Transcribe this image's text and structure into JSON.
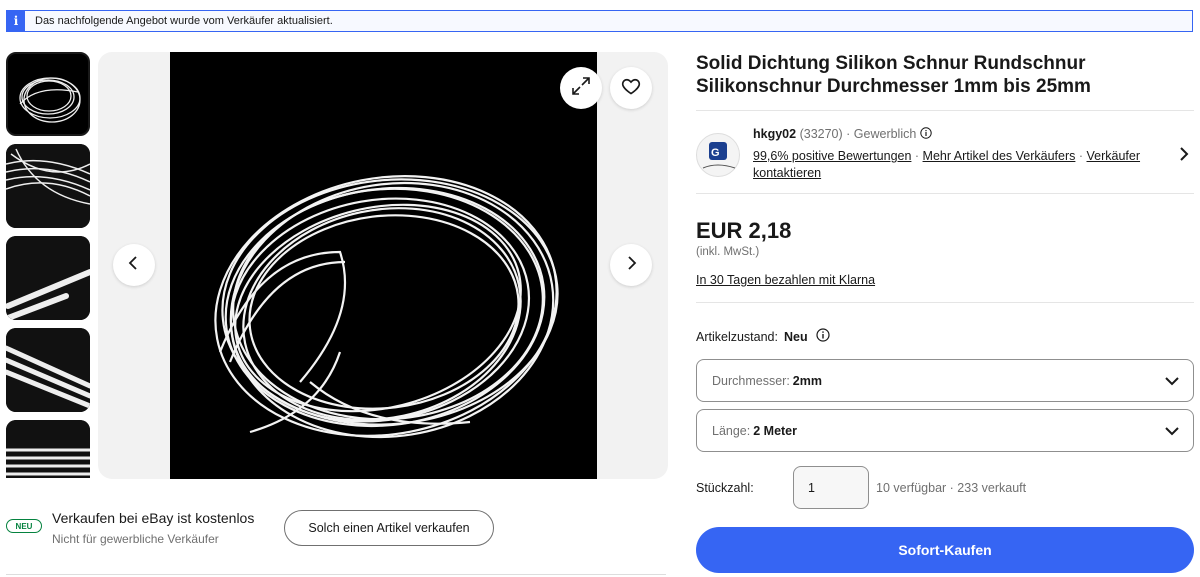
{
  "notice": {
    "icon": "info-icon",
    "text": "Das nachfolgende Angebot wurde vom Verkäufer aktualisiert."
  },
  "gallery": {
    "thumbnails": [
      "thumbnail-1",
      "thumbnail-2",
      "thumbnail-3",
      "thumbnail-4",
      "thumbnail-5"
    ],
    "active_index": 0,
    "icons": {
      "expand": "expand-icon",
      "watch": "heart-icon",
      "prev": "chevron-left-icon",
      "next": "chevron-right-icon"
    }
  },
  "sell_promo": {
    "badge": "NEU",
    "title": "Verkaufen bei eBay ist kostenlos",
    "subtitle": "Nicht für gewerbliche Verkäufer",
    "button": "Solch einen Artikel verkaufen"
  },
  "product": {
    "title": "Solid Dichtung Silikon Schnur Rundschnur Silikonschnur Durchmesser 1mm bis 25mm"
  },
  "seller": {
    "name": "hkgy02",
    "rating_count": "(33270)",
    "type": "· Gewerblich",
    "positive": "99,6% positive Bewertungen",
    "dot1": " · ",
    "more_items": "Mehr Artikel des Verkäufers",
    "dot2": " · ",
    "contact": "Verkäufer kontaktieren"
  },
  "price": {
    "amount": "EUR 2,18",
    "vat": "(inkl. MwSt.)",
    "klarna": "In 30 Tagen bezahlen mit Klarna"
  },
  "condition": {
    "label": "Artikelzustand:",
    "value": "Neu"
  },
  "variations": [
    {
      "label": "Durchmesser:",
      "value": "2mm"
    },
    {
      "label": "Länge:",
      "value": "2 Meter"
    }
  ],
  "quantity": {
    "label": "Stückzahl:",
    "value": "1",
    "availability": "10 verfügbar · 233 verkauft"
  },
  "buy_now": "Sofort-Kaufen",
  "colors": {
    "accent": "#3665f3",
    "green": "#05823f",
    "text": "#191919",
    "muted": "#707070"
  }
}
